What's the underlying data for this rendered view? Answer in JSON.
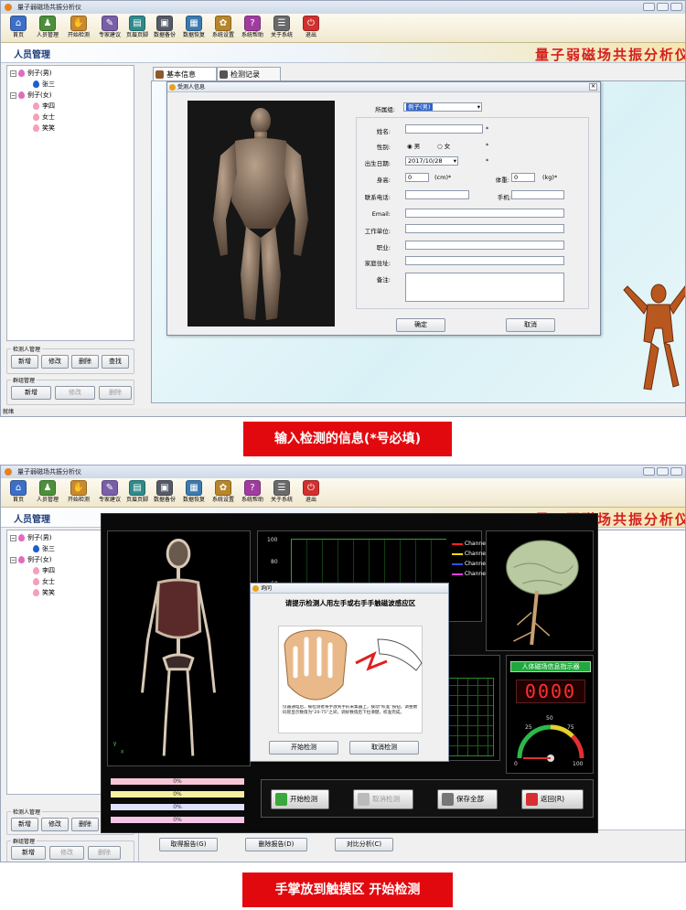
{
  "app": {
    "title": "量子弱磁场共振分析仪",
    "banner": "量子弱磁场共振分析仪",
    "module_title": "人员管理",
    "status_text": "就绪"
  },
  "toolbar": [
    {
      "label": "首页",
      "icon": "home-icon",
      "color": "#3d6fc6"
    },
    {
      "label": "人员管理",
      "icon": "users-icon",
      "color": "#4d8f3a"
    },
    {
      "label": "开始检测",
      "icon": "hand-icon",
      "color": "#c98a2e"
    },
    {
      "label": "专家建议",
      "icon": "expert-icon",
      "color": "#7a5fa8"
    },
    {
      "label": "页眉页脚",
      "icon": "header-footer-icon",
      "color": "#2e8b8b"
    },
    {
      "label": "数据备份",
      "icon": "backup-icon",
      "color": "#555a66"
    },
    {
      "label": "数据恢复",
      "icon": "restore-icon",
      "color": "#3a7ab0"
    },
    {
      "label": "系统设置",
      "icon": "settings-icon",
      "color": "#b8862a"
    },
    {
      "label": "系统帮助",
      "icon": "help-icon",
      "color": "#a03ca0"
    },
    {
      "label": "关于系统",
      "icon": "about-icon",
      "color": "#6a6a6a"
    },
    {
      "label": "退出",
      "icon": "exit-icon",
      "color": "#d23030"
    }
  ],
  "tree": {
    "male_group": "例子(男)",
    "male_member": "张三",
    "female_group": "例子(女)",
    "female_members": [
      "李四",
      "女士",
      "笑笑"
    ]
  },
  "detect_group": {
    "title": "检测人管理",
    "buttons": [
      "新增",
      "修改",
      "删除",
      "查找"
    ]
  },
  "group_mgmt": {
    "title": "群组管理",
    "buttons": [
      "新增",
      "修改",
      "删除"
    ]
  },
  "tabs": [
    "基本信息",
    "检测记录"
  ],
  "person_dialog": {
    "title": "受测人信息",
    "group_label": "所属组:",
    "group_value": "例子(男)",
    "fields": {
      "name": "姓名:",
      "gender": "性别:",
      "gender_male": "男",
      "gender_female": "女",
      "birth": "出生日期:",
      "birth_value": "2017/10/28",
      "height": "身高:",
      "height_value": "0",
      "height_unit": "(cm)*",
      "weight": "体重:",
      "weight_value": "0",
      "weight_unit": "(kg)*",
      "phone": "联系电话:",
      "mobile": "手机:",
      "email": "Email:",
      "work": "工作单位:",
      "job": "职业:",
      "address": "家庭住址:",
      "notes": "备注:"
    },
    "required_mark": "*",
    "ok": "确定",
    "cancel": "取消"
  },
  "caption1": "输入检测的信息(*号必填)",
  "caption2": "手掌放到触摸区  开始检测",
  "detect_screen": {
    "chart_ticks": [
      "100",
      "80",
      "60"
    ],
    "channels": [
      {
        "name": "Channel1",
        "color": "#ff2020"
      },
      {
        "name": "Channel2",
        "color": "#ffe000"
      },
      {
        "name": "Channel3",
        "color": "#3050ff"
      },
      {
        "name": "Channel4",
        "color": "#e040e0"
      }
    ],
    "indicator_title": "人体磁场信息指示器",
    "digits": "0000",
    "gauge_labels": [
      "0",
      "25",
      "50",
      "75",
      "100"
    ],
    "gauge_value": 0,
    "progress_bars": [
      {
        "label": "0%",
        "color": "#f6c6d8"
      },
      {
        "label": "0%",
        "color": "#f6f0a0"
      },
      {
        "label": "0%",
        "color": "#dfe2fa"
      },
      {
        "label": "0%",
        "color": "#f6c6e6"
      }
    ],
    "buttons": {
      "start": "开始检测",
      "cancel": "取消检测",
      "save": "保存全部",
      "back": "返回(R)"
    },
    "axis_x": "x",
    "axis_y": "y"
  },
  "prompt_dialog": {
    "title": "询问",
    "message": "请提示检测人用左手或右手手触磁波感应区",
    "note": "仪器通电后，被检测者将手放到手形采集器上，拨动“校准”按钮，调整数码管显示数值为“20-75”之间，调好数值后下拉滑键，校准完成。",
    "start": "开始检测",
    "cancel": "取消检测"
  },
  "bottom_actions": [
    "取得报告(G)",
    "删除报告(D)",
    "对比分析(C)"
  ]
}
